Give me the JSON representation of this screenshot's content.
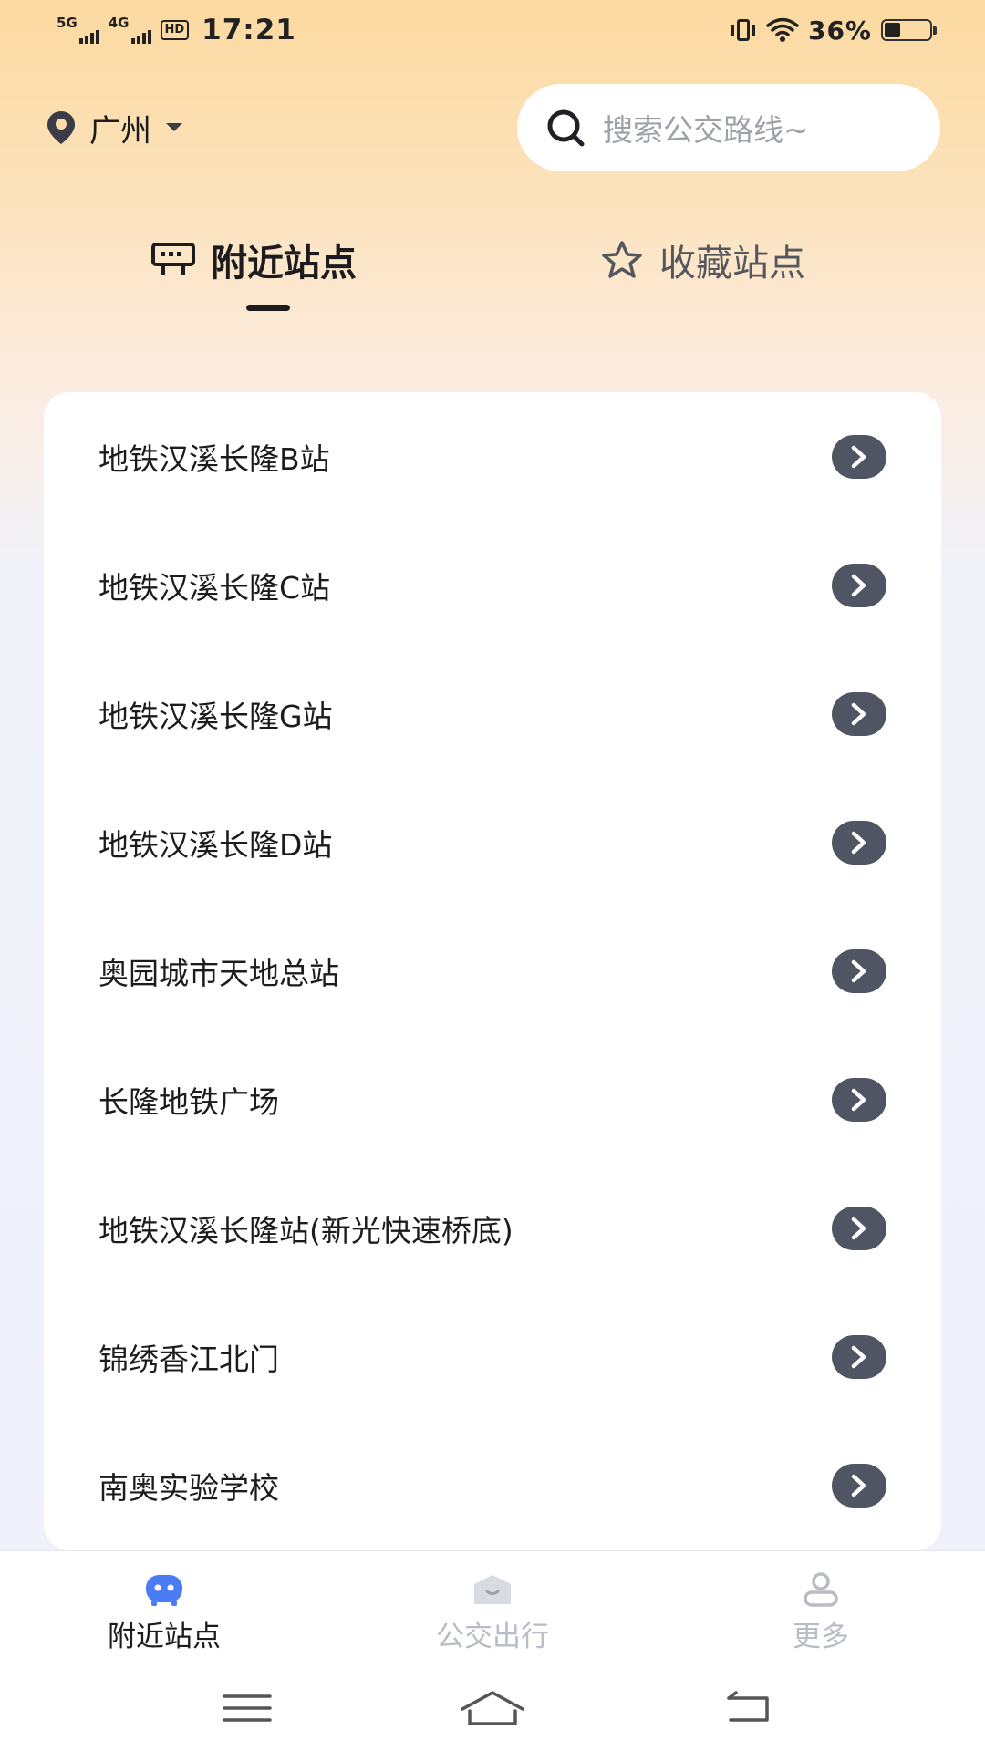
{
  "status_bar": {
    "net1": "5G",
    "net2": "4G",
    "hd": "HD",
    "time": "17:21",
    "battery_pct": "36%",
    "battery_level": 0.36
  },
  "header": {
    "city": "广州",
    "search_placeholder": "搜索公交路线~"
  },
  "tabs": [
    {
      "label": "附近站点",
      "active": true,
      "icon": "bus-stop-sign-icon"
    },
    {
      "label": "收藏站点",
      "active": false,
      "icon": "star-icon"
    }
  ],
  "stations": [
    {
      "name": "地铁汉溪长隆B站"
    },
    {
      "name": "地铁汉溪长隆C站"
    },
    {
      "name": "地铁汉溪长隆G站"
    },
    {
      "name": "地铁汉溪长隆D站"
    },
    {
      "name": "奥园城市天地总站"
    },
    {
      "name": "长隆地铁广场"
    },
    {
      "name": "地铁汉溪长隆站(新光快速桥底)"
    },
    {
      "name": "锦绣香江北门"
    },
    {
      "name": "南奥实验学校"
    }
  ],
  "bottom_nav": [
    {
      "label": "附近站点",
      "icon": "nearby-bus-icon",
      "active": true
    },
    {
      "label": "公交出行",
      "icon": "bus-travel-icon",
      "active": false
    },
    {
      "label": "更多",
      "icon": "user-icon",
      "active": false
    }
  ],
  "colors": {
    "accent": "#4b7cf3",
    "arrow_button": "#4f5562",
    "inactive": "#b9bcc4"
  }
}
